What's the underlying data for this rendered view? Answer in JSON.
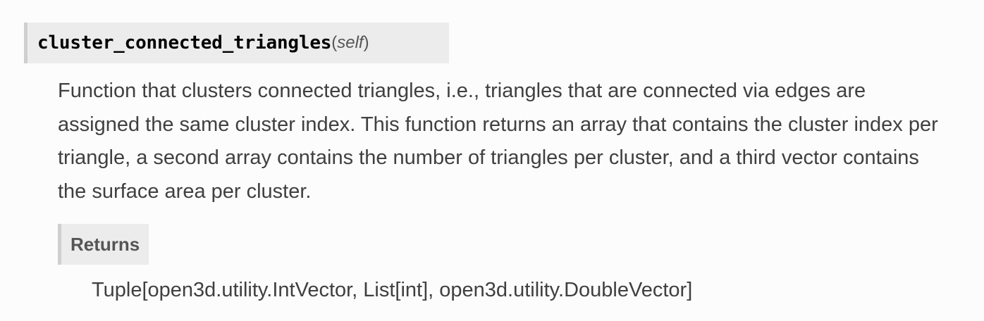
{
  "signature": {
    "name": "cluster_connected_triangles",
    "open_paren": "(",
    "param": "self",
    "close_paren": ")"
  },
  "description": "Function that clusters connected triangles, i.e., triangles that are connected via edges are assigned the same cluster index. This function returns an array that contains the cluster index per triangle, a second array contains the number of triangles per cluster, and a third vector contains the surface area per cluster.",
  "returns": {
    "label": "Returns",
    "value": "Tuple[open3d.utility.IntVector, List[int], open3d.utility.DoubleVector]"
  }
}
